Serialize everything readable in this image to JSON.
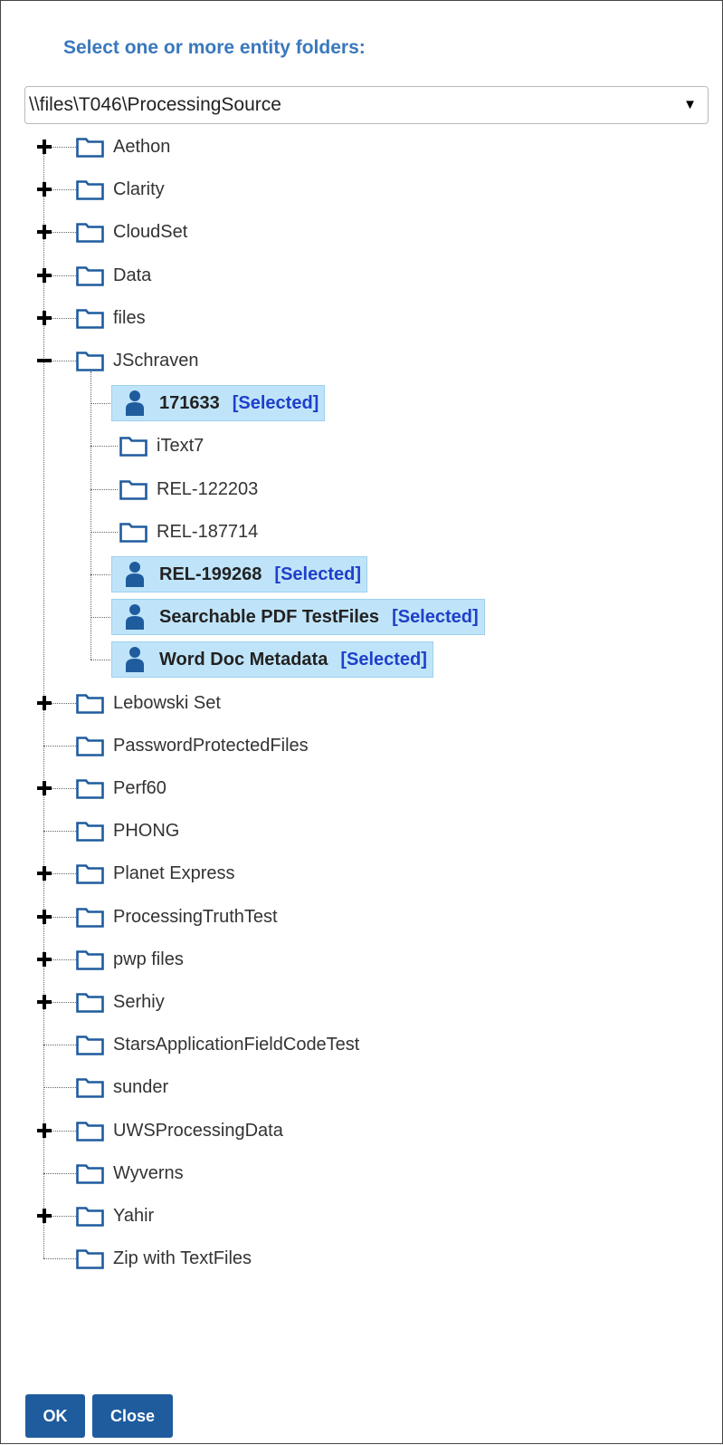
{
  "dialog": {
    "heading": "Select one or more entity folders:",
    "path_select": {
      "value": "\\\\files\\T046\\ProcessingSource"
    },
    "buttons": {
      "ok": "OK",
      "close": "Close"
    },
    "tree": [
      {
        "label": "Aethon",
        "type": "folder",
        "level": 0,
        "expander": "plus"
      },
      {
        "label": "Clarity",
        "type": "folder",
        "level": 0,
        "expander": "plus"
      },
      {
        "label": "CloudSet",
        "type": "folder",
        "level": 0,
        "expander": "plus"
      },
      {
        "label": "Data",
        "type": "folder",
        "level": 0,
        "expander": "plus"
      },
      {
        "label": "files",
        "type": "folder",
        "level": 0,
        "expander": "plus"
      },
      {
        "label": "JSchraven",
        "type": "folder",
        "level": 0,
        "expander": "minus"
      },
      {
        "label": "171633",
        "type": "entity",
        "level": 1,
        "selected": true,
        "tag": "[Selected]"
      },
      {
        "label": "iText7",
        "type": "folder",
        "level": 1
      },
      {
        "label": "REL-122203",
        "type": "folder",
        "level": 1
      },
      {
        "label": "REL-187714",
        "type": "folder",
        "level": 1
      },
      {
        "label": "REL-199268",
        "type": "entity",
        "level": 1,
        "selected": true,
        "tag": "[Selected]"
      },
      {
        "label": "Searchable PDF TestFiles",
        "type": "entity",
        "level": 1,
        "selected": true,
        "tag": "[Selected]"
      },
      {
        "label": "Word Doc Metadata",
        "type": "entity",
        "level": 1,
        "selected": true,
        "tag": "[Selected]"
      },
      {
        "label": "Lebowski Set",
        "type": "folder",
        "level": 0,
        "expander": "plus"
      },
      {
        "label": "PasswordProtectedFiles",
        "type": "folder",
        "level": 0
      },
      {
        "label": "Perf60",
        "type": "folder",
        "level": 0,
        "expander": "plus"
      },
      {
        "label": "PHONG",
        "type": "folder",
        "level": 0
      },
      {
        "label": "Planet Express",
        "type": "folder",
        "level": 0,
        "expander": "plus"
      },
      {
        "label": "ProcessingTruthTest",
        "type": "folder",
        "level": 0,
        "expander": "plus"
      },
      {
        "label": "pwp files",
        "type": "folder",
        "level": 0,
        "expander": "plus"
      },
      {
        "label": "Serhiy",
        "type": "folder",
        "level": 0,
        "expander": "plus"
      },
      {
        "label": "StarsApplicationFieldCodeTest",
        "type": "folder",
        "level": 0
      },
      {
        "label": "sunder",
        "type": "folder",
        "level": 0
      },
      {
        "label": "UWSProcessingData",
        "type": "folder",
        "level": 0,
        "expander": "plus"
      },
      {
        "label": "Wyverns",
        "type": "folder",
        "level": 0
      },
      {
        "label": "Yahir",
        "type": "folder",
        "level": 0,
        "expander": "plus"
      },
      {
        "label": "Zip with TextFiles",
        "type": "folder",
        "level": 0
      }
    ]
  },
  "colors": {
    "heading": "#3a78bd",
    "selected_bg": "#bfe4f9",
    "selected_tag": "#1f3fc9",
    "icon": "#1f5c9e",
    "button_bg": "#1f5c9e"
  },
  "icons": {
    "folder": "folder-icon",
    "entity": "user-icon",
    "expand": "plus-icon",
    "collapse": "minus-icon",
    "dropdown": "dropdown-arrow-icon"
  }
}
